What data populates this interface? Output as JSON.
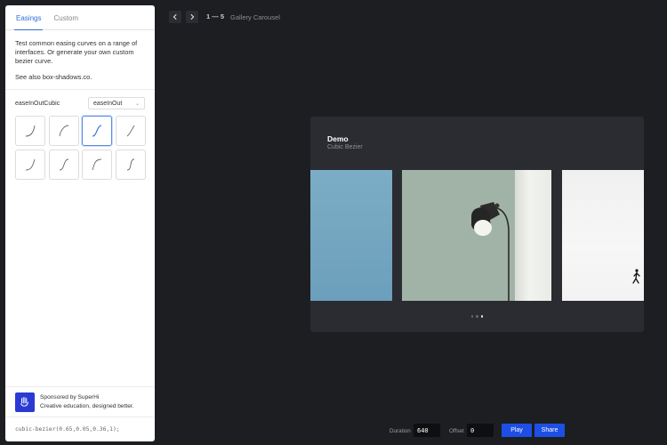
{
  "sidebar": {
    "tabs": [
      {
        "label": "Easings",
        "active": true
      },
      {
        "label": "Custom",
        "active": false
      }
    ],
    "intro": "Test common easing curves on a range of interfaces. Or generate your own custom bezier curve.",
    "see_also_prefix": "See also ",
    "see_also_link": "box-shadows.co",
    "see_also_suffix": ".",
    "easing_name": "easeInOutCubic",
    "select_value": "easeInOut",
    "grid_selected_index": 2,
    "sponsor": {
      "title": "Sponsored by SuperHi",
      "subtitle": "Creative education, designed better."
    },
    "code": "cubic-bezier(0.65,0.05,0.36,1);"
  },
  "nav": {
    "prev_icon": "chevron-left-icon",
    "next_icon": "chevron-right-icon",
    "counter": "1 — 5",
    "title": "Gallery Carousel"
  },
  "demo": {
    "title": "Demo",
    "subtitle": "Cubic Bezier",
    "active_dot": 2,
    "dot_count": 3
  },
  "controls": {
    "duration_label": "Duration",
    "duration_value": "640",
    "offset_label": "Offset",
    "offset_value": "0",
    "play_label": "Play",
    "share_label": "Share"
  },
  "colors": {
    "accent": "#1d4fe6",
    "background": "#1d1e22",
    "tab_active": "#2f6fd6"
  }
}
